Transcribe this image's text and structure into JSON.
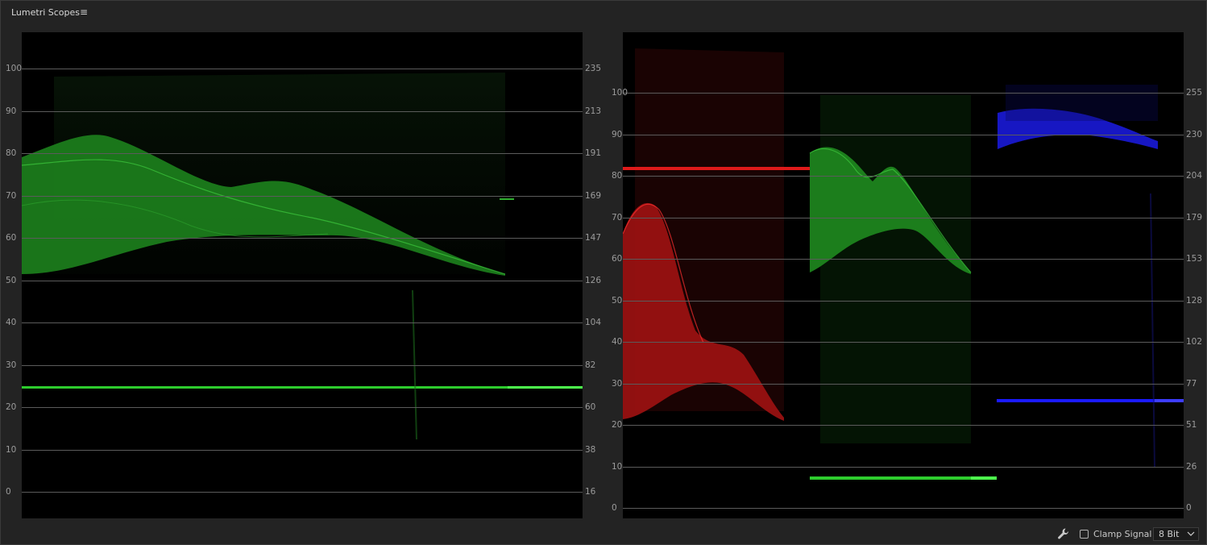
{
  "panel": {
    "title": "Lumetri Scopes",
    "menu_icon": "hamburger-menu-icon"
  },
  "luma_waveform": {
    "left_axis": [
      "100",
      "90",
      "80",
      "70",
      "60",
      "50",
      "40",
      "30",
      "20",
      "10",
      "0"
    ],
    "right_axis": [
      "235",
      "213",
      "191",
      "169",
      "147",
      "126",
      "104",
      "82",
      "60",
      "38",
      "16"
    ],
    "trace_color": "#2fae2f"
  },
  "rgb_parade": {
    "left_axis": [
      "100",
      "90",
      "80",
      "70",
      "60",
      "50",
      "40",
      "30",
      "20",
      "10",
      "0"
    ],
    "right_axis": [
      "255",
      "230",
      "204",
      "179",
      "153",
      "128",
      "102",
      "77",
      "51",
      "26",
      "0"
    ],
    "channel_colors": {
      "red": "#d81818",
      "green": "#2fb02f",
      "blue": "#1a1aff"
    }
  },
  "footer": {
    "settings_icon": "wrench-icon",
    "clamp_label": "Clamp Signal",
    "clamp_checked": false,
    "bit_depth": "8 Bit",
    "bit_depth_icon": "chevron-down-icon"
  }
}
